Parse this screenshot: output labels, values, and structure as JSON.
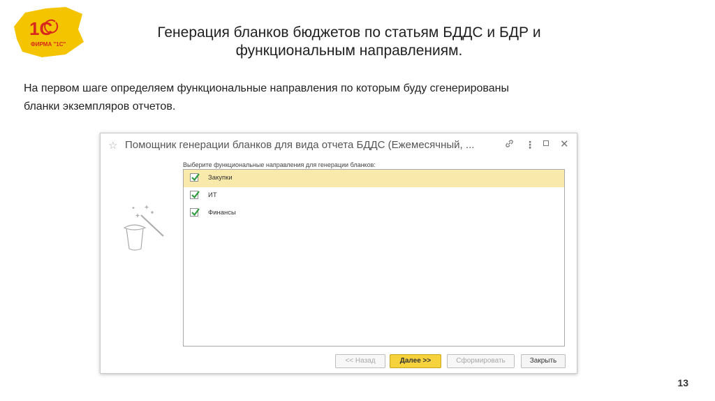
{
  "slide": {
    "title_line1": "Генерация бланков бюджетов по статьям БДДС и БДР и",
    "title_line2": "функциональным направлениям.",
    "text_line1": "На первом шаге определяем функциональные направления по которым буду сгенерированы",
    "text_line2": "бланки экземпляров отчетов.",
    "page_number": "13"
  },
  "logo": {
    "main": "1С",
    "caption": "ФИРМА \"1С\"",
    "color": "#f5c400",
    "accent": "#d6281e"
  },
  "window": {
    "title": "Помощник генерации бланков для вида отчета БДДС (Ежемесячный, ...",
    "star_icon": "star-icon",
    "prompt": "Выберите функциональные направления для генерации бланков:",
    "items": [
      {
        "label": "Закупки",
        "checked": true,
        "selected": true
      },
      {
        "label": "ИТ",
        "checked": true,
        "selected": false
      },
      {
        "label": "Финансы",
        "checked": true,
        "selected": false
      }
    ],
    "buttons": {
      "back": "<< Назад",
      "next": "Далее >>",
      "form": "Сформировать",
      "close": "Закрыть"
    },
    "colors": {
      "selected_row": "#f9eaab",
      "primary_button": "#f6d23c",
      "check": "#2e9b3e"
    }
  }
}
